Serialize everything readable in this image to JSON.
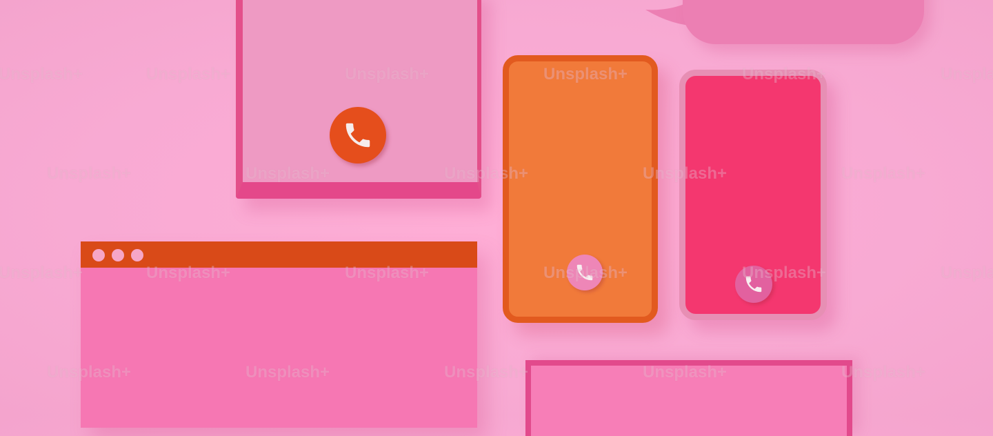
{
  "watermark": {
    "text": "Unsplash+"
  },
  "colors": {
    "background": "#f8aad3",
    "tablet_face": "#ee9ac3",
    "tablet_frame": "#e4488a",
    "orange_phone": "#f17a3a",
    "pink_phone": "#f4376f",
    "browser_body": "#f677b3",
    "browser_bar": "#d94a18",
    "call_button_orange": "#e54e1c",
    "call_button_pink": "#ee86b7"
  },
  "icons": {
    "call": "phone-handset-icon",
    "window_controls": "window-dots-icon",
    "speech_bubble": "speech-bubble-icon"
  }
}
